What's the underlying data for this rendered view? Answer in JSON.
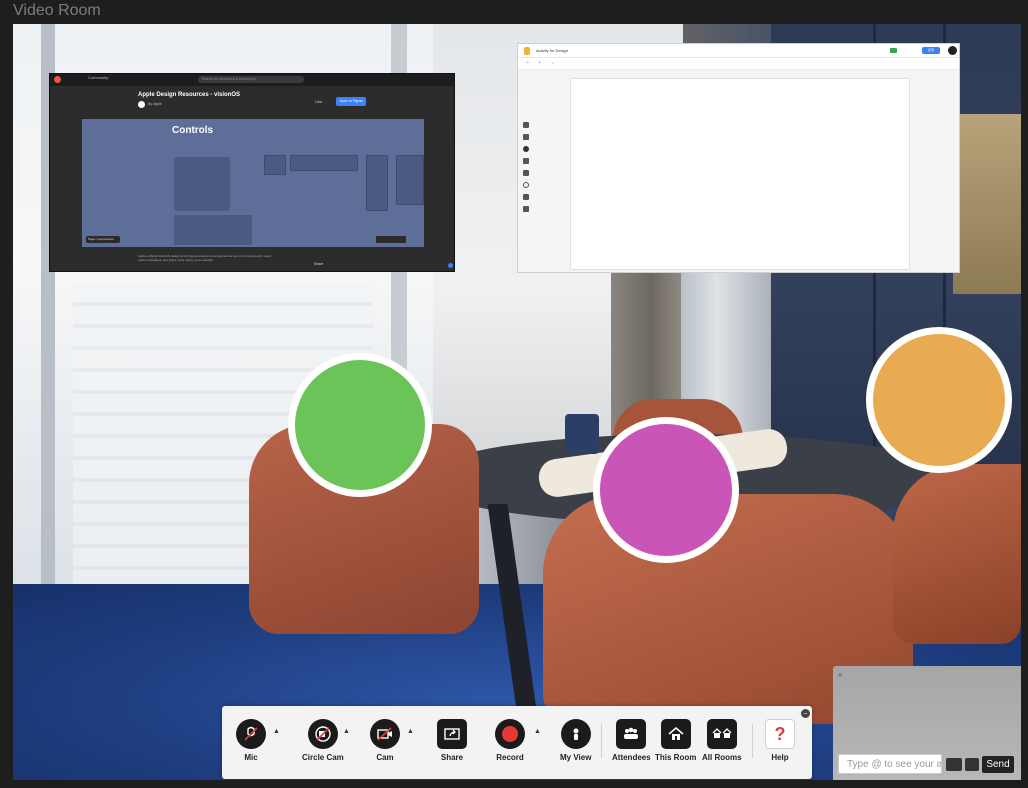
{
  "window": {
    "title": "Video Room"
  },
  "shared_screen_1": {
    "top_links": [
      "Community"
    ],
    "search_placeholder": "Search for resources & community",
    "heading": "Apple Design Resources - visionOS",
    "byline": "By Apple",
    "like_label": "Like",
    "open_button": "Open in Figma",
    "canvas_title": "Controls",
    "pages_label": "Page: Components",
    "description": "Apple's official visionOS design kit for Figma contains a comprehensive set of UI components, views, system interfaces, text styles, color styles, and materials.",
    "share_label": "Share"
  },
  "shared_screen_2": {
    "doc_title": "Activity for Design",
    "toolbar_items": [
      "",
      ""
    ],
    "share_button": "공유"
  },
  "participants": [
    {
      "id": "participant-green",
      "color": "#6ac458"
    },
    {
      "id": "participant-magenta",
      "color": "#c956b7"
    },
    {
      "id": "participant-orange",
      "color": "#e8ab52"
    }
  ],
  "chat": {
    "input_placeholder": "Type @ to see your atte",
    "send_label": "Send"
  },
  "controls": {
    "mic": "Mic",
    "circle_cam": "Circle Cam",
    "cam": "Cam",
    "share": "Share",
    "record": "Record",
    "my_view": "My View",
    "attendees": "Attendees",
    "this_room": "This Room",
    "all_rooms": "All Rooms",
    "help": "Help",
    "help_glyph": "?"
  },
  "colors": {
    "record_red": "#e53935",
    "send_bg": "#222222",
    "help_red": "#e03a3a"
  }
}
